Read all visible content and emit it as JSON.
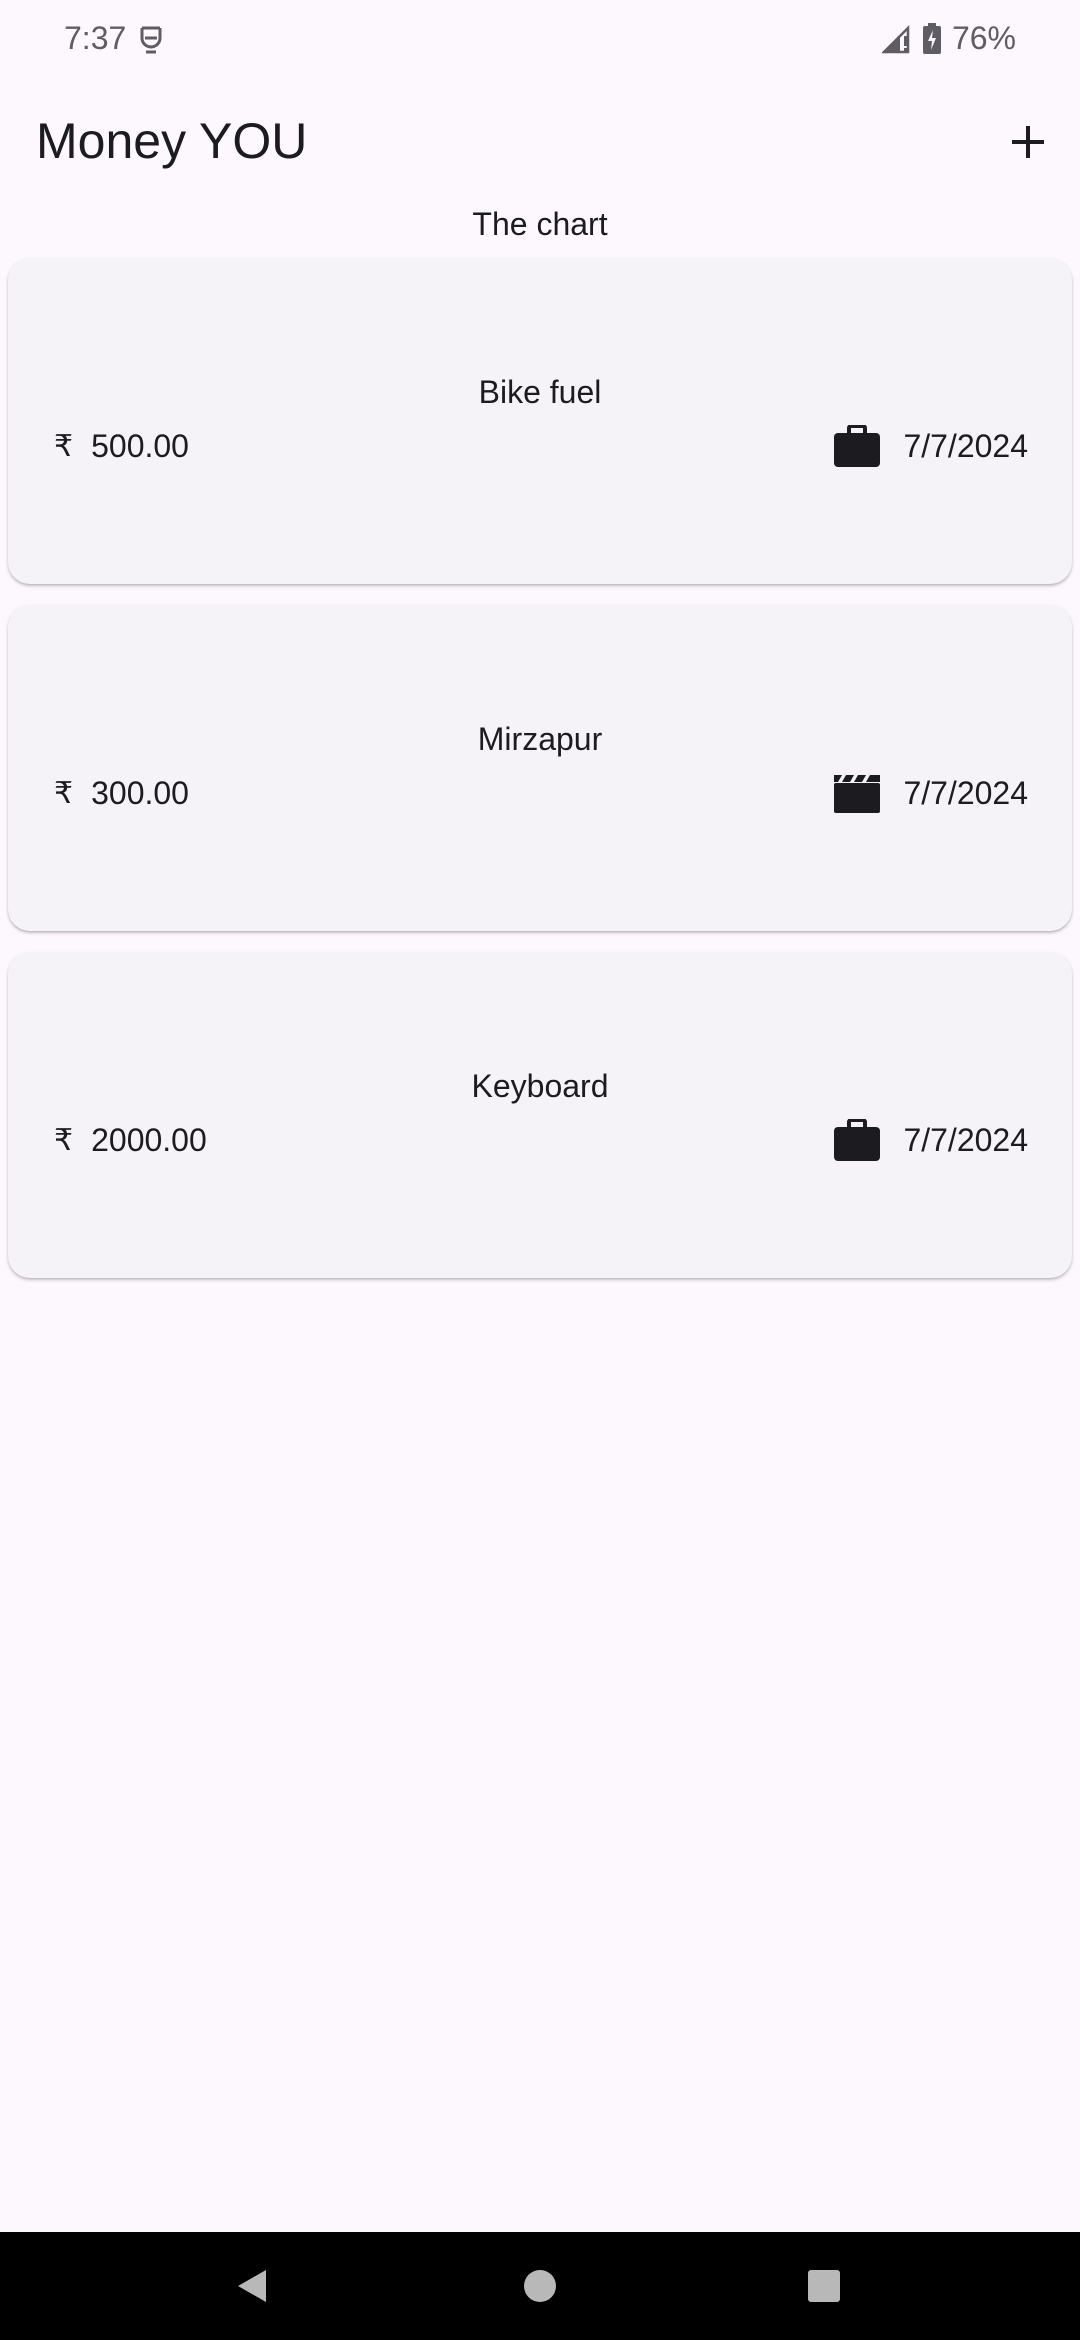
{
  "status_bar": {
    "time": "7:37",
    "battery": "76%",
    "app_icon": "notification-app-icon",
    "signal_icon": "signal-no-data-icon",
    "battery_icon": "battery-charging-icon"
  },
  "app_bar": {
    "title": "Money YOU",
    "add_icon": "plus-icon"
  },
  "chart_label": "The chart",
  "currency_symbol": "₹",
  "expenses": [
    {
      "title": "Bike fuel",
      "amount": "500.00",
      "date": "7/7/2024",
      "category_icon": "briefcase-icon"
    },
    {
      "title": "Mirzapur",
      "amount": "300.00",
      "date": "7/7/2024",
      "category_icon": "movie-clapper-icon"
    },
    {
      "title": "Keyboard",
      "amount": "2000.00",
      "date": "7/7/2024",
      "category_icon": "briefcase-icon"
    }
  ],
  "nav_bar": {
    "back_icon": "back-triangle-icon",
    "home_icon": "home-circle-icon",
    "recents_icon": "recents-square-icon"
  },
  "colors": {
    "background": "#fdf7fe",
    "card": "#f5f2f8",
    "text": "#1c1b1f",
    "nav_bar": "#000000"
  }
}
